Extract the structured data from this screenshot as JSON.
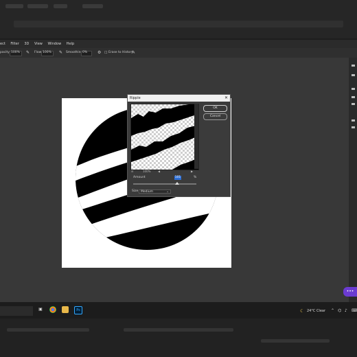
{
  "app": {
    "name": "Photoshop"
  },
  "menu": {
    "items": [
      "ect",
      "Filter",
      "3D",
      "View",
      "Window",
      "Help"
    ]
  },
  "options": {
    "opacity_label": "pacity:",
    "opacity_value": "100%",
    "flow_label": "Flow:",
    "flow_value": "100%",
    "smoothing_label": "Smoothing:",
    "smoothing_value": "0%",
    "erase_label": "Erase to History"
  },
  "dialog": {
    "title": "Ripple",
    "ok_label": "OK",
    "cancel_label": "Cancel",
    "zoom_value": "100%",
    "amount_label": "Amount",
    "amount_value": "101",
    "amount_unit": "%",
    "amount_fraction": 0.7,
    "size_label": "Size",
    "size_value": "Medium"
  },
  "taskbar": {
    "weather": "24°C  Clear",
    "ps_label": "Ps"
  },
  "colors": {
    "selection_blue": "#2d6fd6",
    "notification_purple": "#6b3bd1"
  }
}
